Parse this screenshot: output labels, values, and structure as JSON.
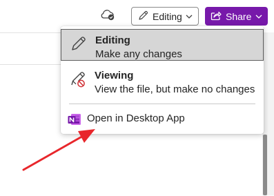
{
  "toolbar": {
    "cloud_status_icon": "cloud-sync-icon",
    "editing_label": "Editing",
    "share_label": "Share",
    "share_color": "#7719aa"
  },
  "menu": {
    "items": [
      {
        "title": "Editing",
        "subtitle": "Make any changes",
        "icon": "pencil-icon",
        "selected": true
      },
      {
        "title": "Viewing",
        "subtitle": "View the file, but make no changes",
        "icon": "pencil-blocked-icon",
        "selected": false
      }
    ],
    "open_desktop_label": "Open in Desktop App",
    "open_desktop_icon": "onenote-app-icon",
    "annotation_color": "#e8262b"
  }
}
